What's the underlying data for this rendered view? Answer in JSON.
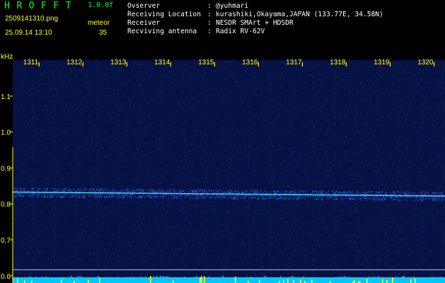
{
  "header": {
    "app_name": "HROFFT",
    "app_version": "1.0.0f",
    "filename": "2509141310.png",
    "mode": "meteor",
    "timestamp": "25.09.14 13:10",
    "count": "35"
  },
  "info": {
    "rows": [
      {
        "label": "Ovserver",
        "value": "@yuhmari"
      },
      {
        "label": "Receiving Location",
        "value": "kurashiki,Okayama,JAPAN (133.77E, 34.58N)"
      },
      {
        "label": "Receiver",
        "value": "NESDR SMArt + HDSDR"
      },
      {
        "label": "Recviving antenna",
        "value": "Radix RV-62V"
      }
    ],
    "colon": ":"
  },
  "chart_data": {
    "type": "heatmap",
    "ylabel": "kHz",
    "x_ticks": [
      "1311",
      "1312",
      "1313",
      "1314",
      "1315",
      "1316",
      "1317",
      "1318",
      "1319",
      "1320"
    ],
    "y_ticks": [
      1.1,
      1.0,
      0.9,
      0.8,
      0.7,
      0.6
    ],
    "ylim": [
      0.58,
      1.2
    ],
    "xlim": [
      1310.4,
      1320.25
    ],
    "reference_line": {
      "x": [
        1310.4,
        1320.25
      ],
      "y": [
        0.833,
        0.822
      ]
    },
    "horizontal_markers_khz": [
      0.617,
      0.595
    ],
    "colors": {
      "background": "#000000",
      "plot": "#071244",
      "noise": "#1a2e86",
      "signal": "#3fe9ff",
      "ticks": "#ffff00",
      "app_name": "#00ff33",
      "info_text": "#ffffff",
      "markers": "#c4c4cc",
      "bottom_band": "#00c8ff",
      "bottom_spike": "#ffff00"
    }
  }
}
